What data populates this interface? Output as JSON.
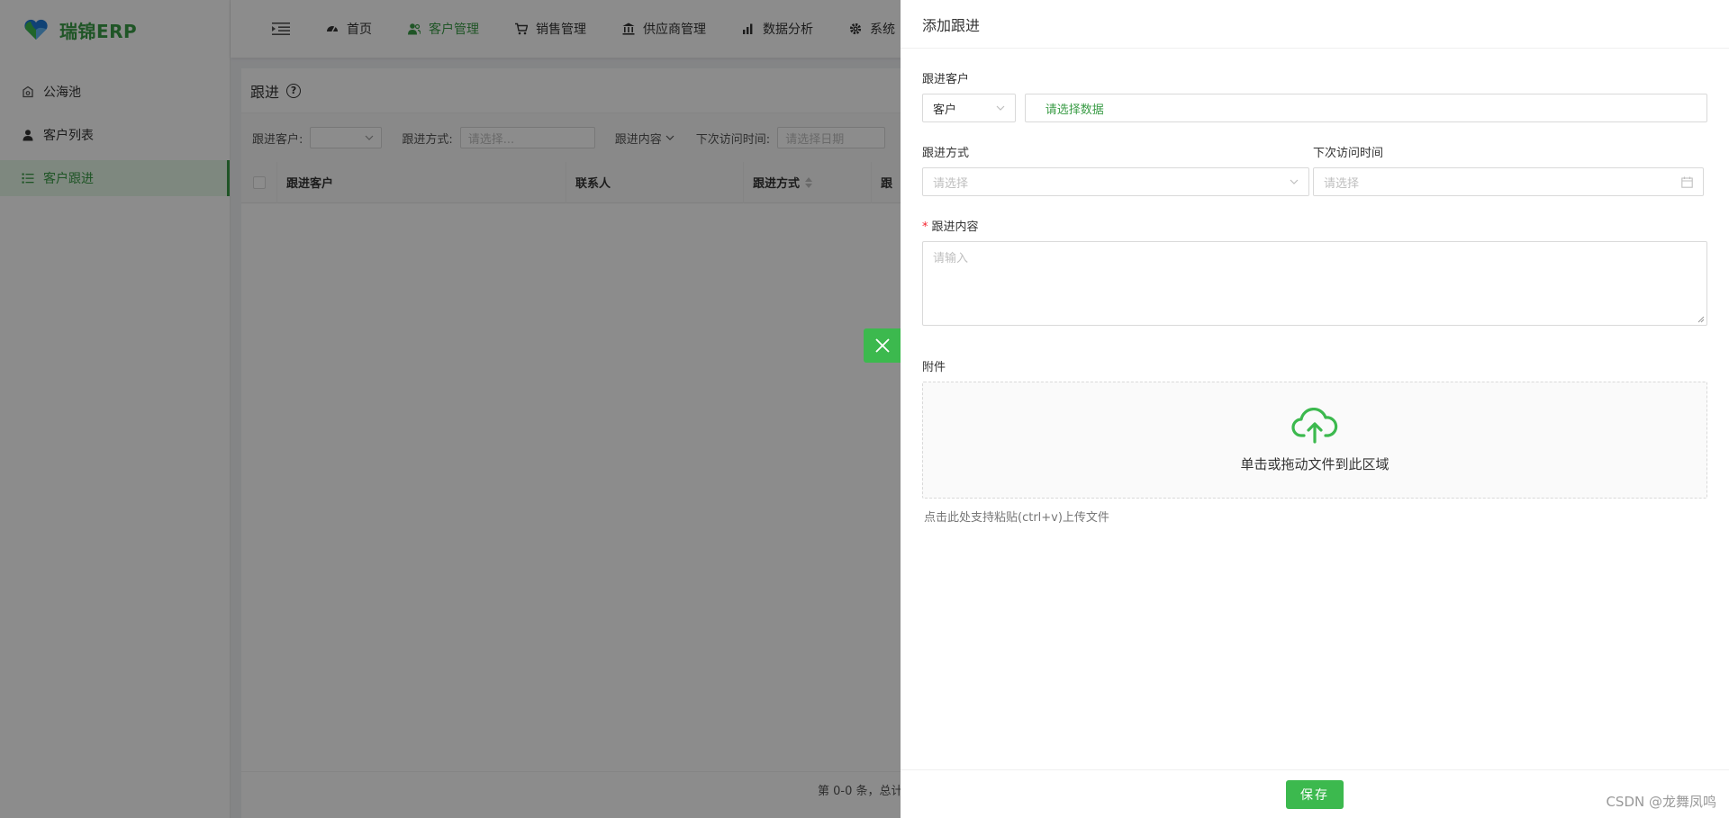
{
  "app": {
    "name": "瑞锦ERP"
  },
  "sidebar": {
    "items": [
      {
        "label": "公海池",
        "icon": "safe-icon"
      },
      {
        "label": "客户列表",
        "icon": "user-icon"
      },
      {
        "label": "客户跟进",
        "icon": "list-icon",
        "active": true
      }
    ]
  },
  "topnav": {
    "items": [
      {
        "label": "首页",
        "icon": "dashboard-icon"
      },
      {
        "label": "客户管理",
        "icon": "users-icon",
        "active": true
      },
      {
        "label": "销售管理",
        "icon": "cart-icon"
      },
      {
        "label": "供应商管理",
        "icon": "bank-icon"
      },
      {
        "label": "数据分析",
        "icon": "bar-chart-icon"
      },
      {
        "label": "系统",
        "icon": "gear-icon"
      }
    ]
  },
  "page": {
    "title": "跟进",
    "filters": {
      "customer_label": "跟进客户:",
      "method_label": "跟进方式:",
      "method_placeholder": "请选择...",
      "content_label": "跟进内容",
      "next_visit_label": "下次访问时间:",
      "next_visit_placeholder": "请选择日期"
    },
    "table": {
      "columns": [
        "跟进客户",
        "联系人",
        "跟进方式",
        "跟"
      ]
    },
    "pager": {
      "text": "第 0-0 条，总计"
    }
  },
  "drawer": {
    "title": "添加跟进",
    "fields": {
      "customer": {
        "label": "跟进客户",
        "type_value": "客户",
        "placeholder": "请选择数据"
      },
      "method": {
        "label": "跟进方式",
        "placeholder": "请选择"
      },
      "next_visit": {
        "label": "下次访问时间",
        "placeholder": "请选择"
      },
      "content": {
        "label": "跟进内容",
        "required": true,
        "placeholder": "请输入"
      },
      "attachment": {
        "label": "附件",
        "upload_text": "单击或拖动文件到此区域",
        "hint": "点击此处支持粘贴(ctrl+v)上传文件"
      }
    },
    "save_label": "保存"
  },
  "watermark": "CSDN @龙舞凤鸣",
  "colors": {
    "accent": "#3cb94e",
    "accent_text": "#3a9c46",
    "required": "#f5222d"
  }
}
